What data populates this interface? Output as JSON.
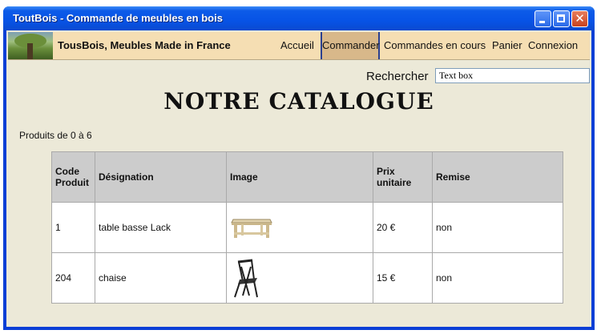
{
  "window": {
    "title": "ToutBois - Commande de meubles en bois"
  },
  "nav": {
    "brand": "TousBois, Meubles Made in France",
    "items": [
      {
        "id": "accueil",
        "label": "Accueil"
      },
      {
        "id": "commander",
        "label": "Commander",
        "active": true
      },
      {
        "id": "commandes-en-cours",
        "label": "Commandes en cours"
      },
      {
        "id": "panier",
        "label": "Panier"
      },
      {
        "id": "connexion",
        "label": "Connexion"
      }
    ]
  },
  "search": {
    "label": "Rechercher",
    "value": "Text box"
  },
  "page": {
    "title": "NOTRE CATALOGUE",
    "count_text": "Produits de 0 à 6"
  },
  "table": {
    "headers": {
      "code_line1": "Code",
      "code_line2": "Produit",
      "designation": "Désignation",
      "image": "Image",
      "prix_line1": "Prix",
      "prix_line2": "unitaire",
      "remise": "Remise"
    },
    "rows": [
      {
        "code": "1",
        "designation": "table basse Lack",
        "image_icon": "coffee-table-icon",
        "prix": "20 €",
        "remise": "non"
      },
      {
        "code": "204",
        "designation": "chaise",
        "image_icon": "folding-chair-icon",
        "prix": "15 €",
        "remise": "non"
      }
    ]
  },
  "colors": {
    "titlebar": "#0753e6",
    "client_bg": "#ece9d8",
    "navbar_bg": "#f5deb3",
    "nav_active_bg": "#d8b88a",
    "header_bg": "#cccccc"
  }
}
